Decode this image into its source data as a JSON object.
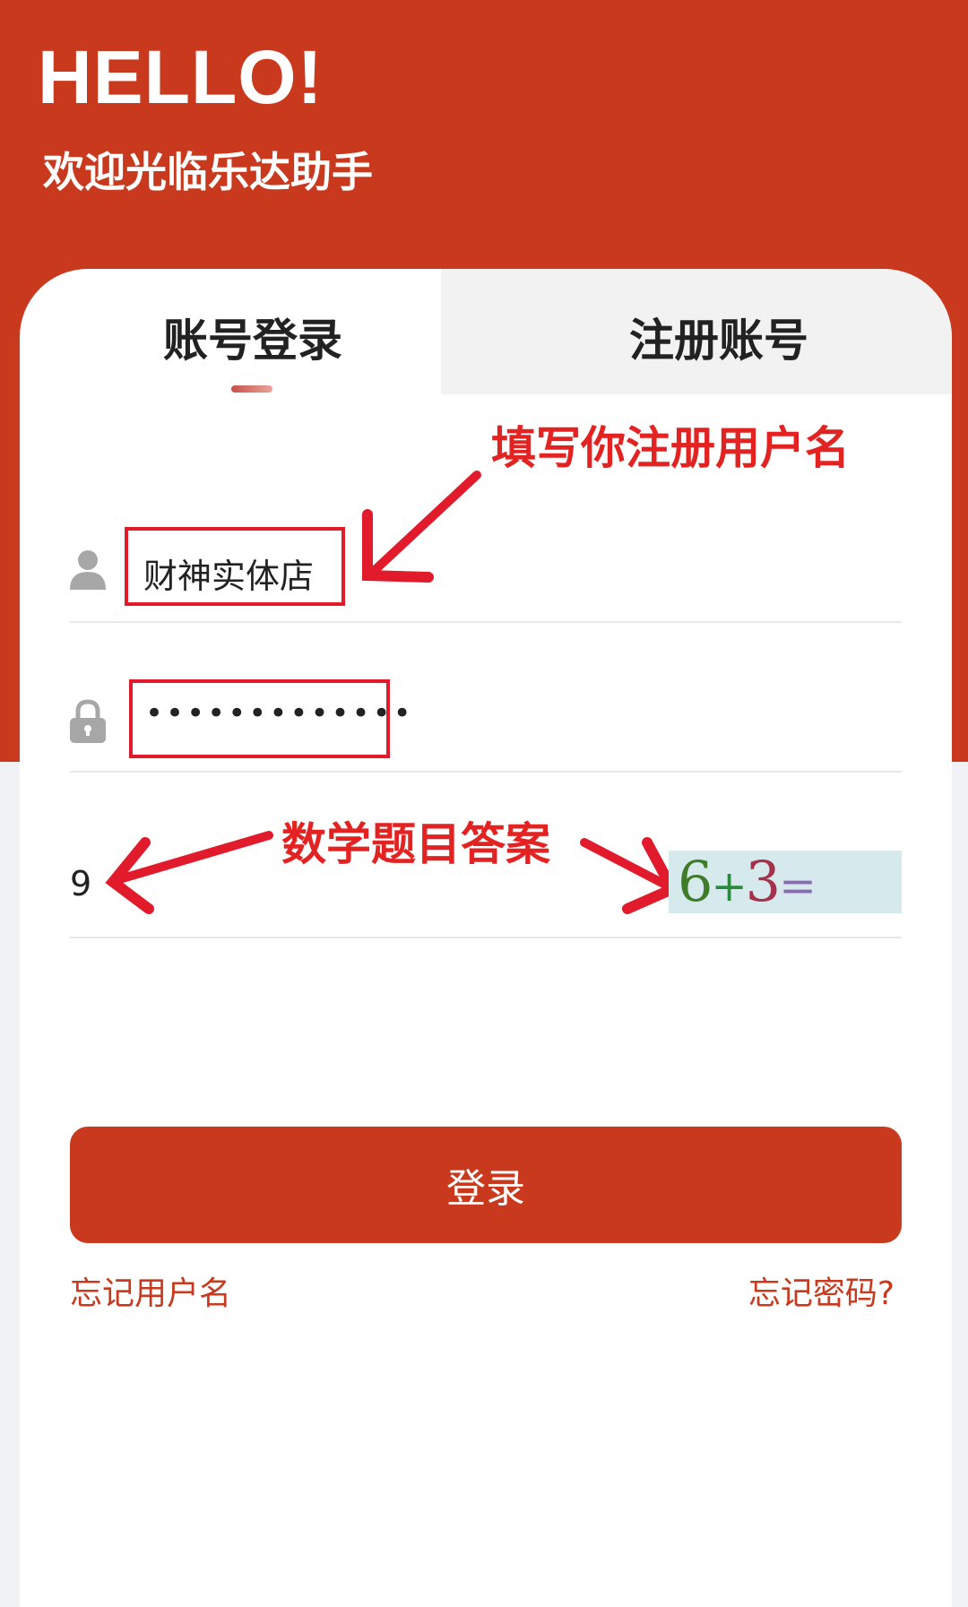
{
  "header": {
    "hello": "HELLO!",
    "welcome": "欢迎光临乐达助手"
  },
  "tabs": [
    {
      "label": "账号登录",
      "active": true
    },
    {
      "label": "注册账号",
      "active": false
    }
  ],
  "form": {
    "username_value": "财神实体店",
    "password_mask": "•••••••••••••",
    "captcha_answer": "9",
    "captcha": {
      "a": "6",
      "op": "+",
      "b": "3",
      "eq": "="
    }
  },
  "annotations": {
    "username_hint": "填写你注册用户名",
    "captcha_hint": "数学题目答案"
  },
  "buttons": {
    "login": "登录"
  },
  "links": {
    "forgot_username": "忘记用户名",
    "forgot_password": "忘记密码?"
  },
  "colors": {
    "brand": "#c8391d",
    "annotation": "#e21b2c"
  }
}
